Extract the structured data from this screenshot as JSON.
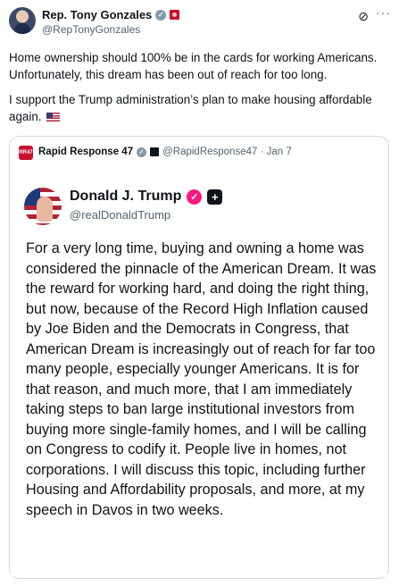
{
  "post": {
    "author_name": "Rep. Tony Gonzales",
    "author_handle": "@RepTonyGonzales",
    "verified_mark": "✓",
    "text_line1": "Home ownership should 100% be in the cards for working Americans. Unfortunately, this dream has been out of reach for too long.",
    "text_line2": "I support the Trump administration’s plan to make housing affordable again.",
    "flag_emoji": "us-flag-icon"
  },
  "quote": {
    "source_name": "Rapid Response 47",
    "source_handle": "@RapidResponse47 · Jan 7",
    "source_logo_text": "RR47",
    "inner": {
      "author_name": "Donald J. Trump",
      "author_handle": "@realDonaldTrump",
      "plus_mark": "+",
      "badge_mark": "✓",
      "text": "For a very long time, buying and owning a home was considered the pinnacle of the American Dream. It was the reward for working hard, and doing the right thing, but now, because of the Record High Inflation caused by Joe Biden and the Democrats in Congress, that American Dream is increasingly out of reach for far too many people, especially younger Americans. It is for that reason, and much more, that I am immediately taking steps to ban large institutional investors from buying more single-family homes, and I will be calling on Congress to codify it. People live in homes, not corporations. I will discuss this topic, including further Housing and Affordability proposals, and more, at my speech in Davos in two weeks."
    }
  },
  "icons": {
    "grok": "⊘",
    "more": "···"
  }
}
